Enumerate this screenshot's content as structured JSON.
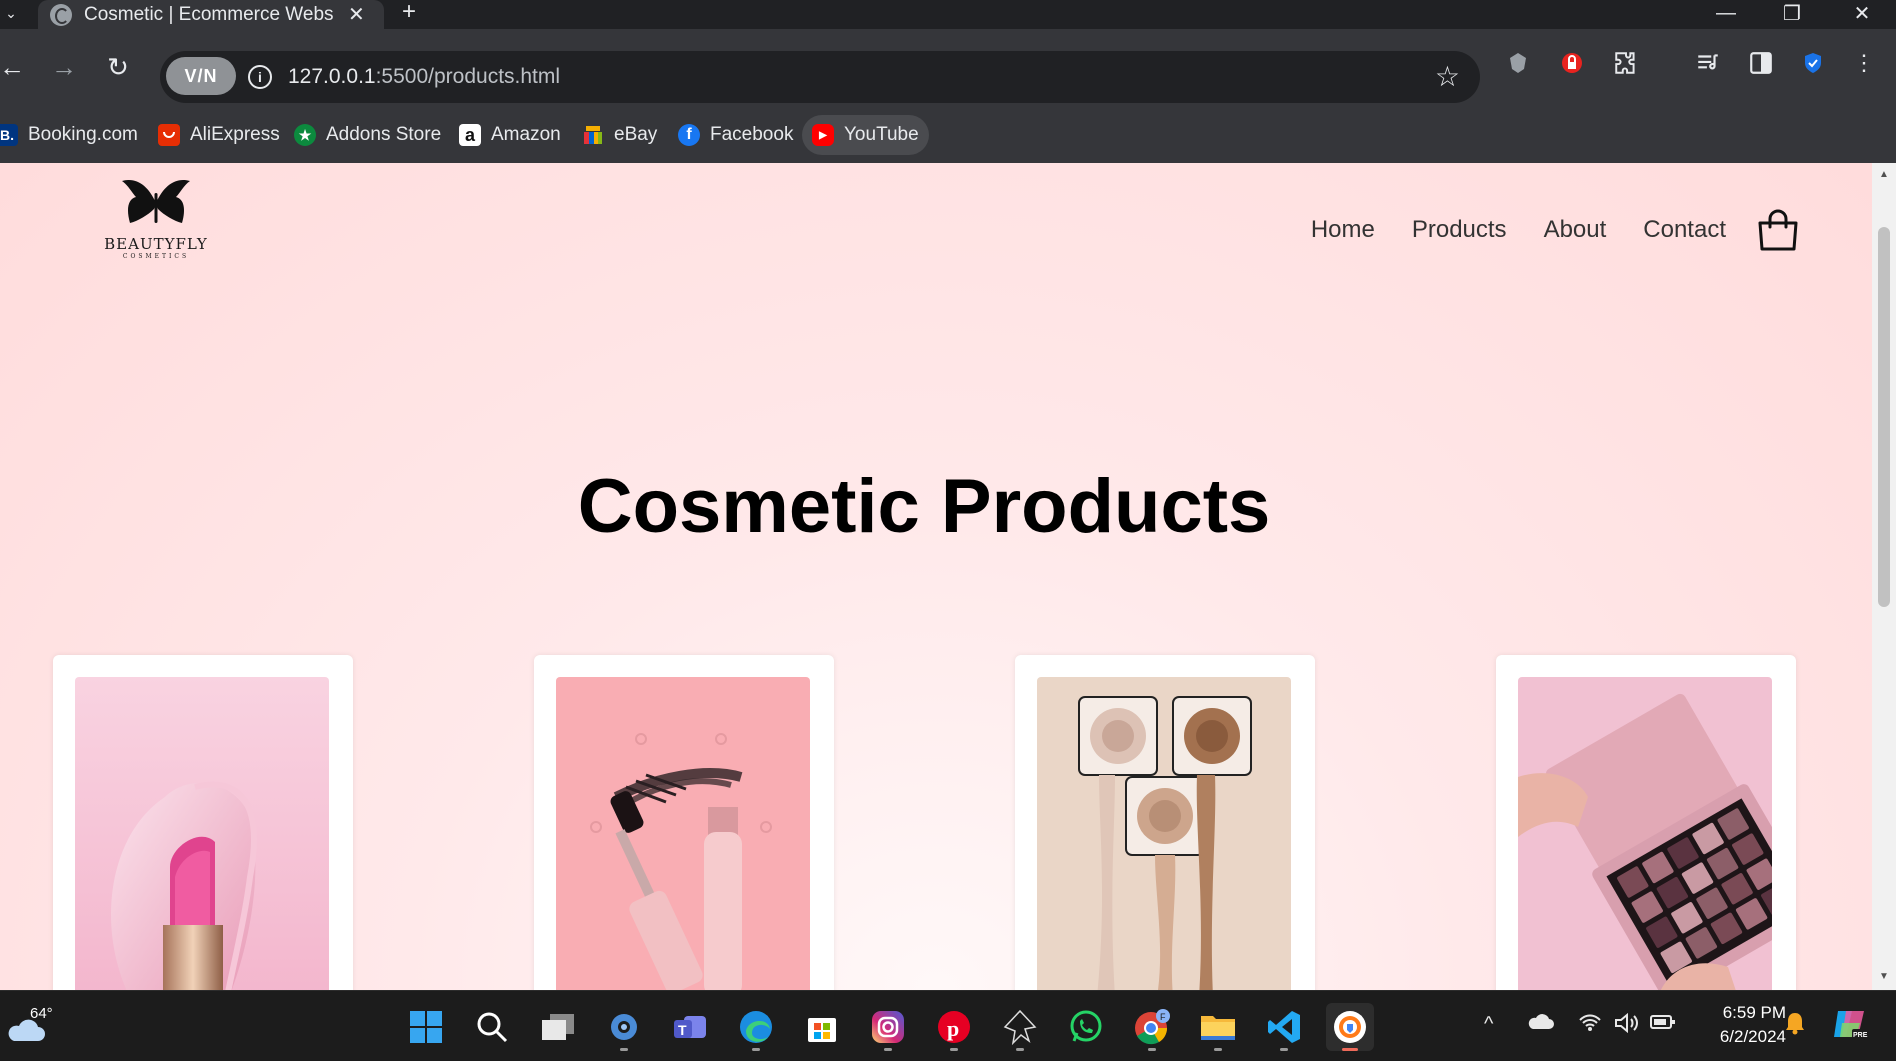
{
  "browser": {
    "tab_title": "Cosmetic | Ecommerce Website",
    "new_tab_symbol": "+",
    "url_host": "127.0.0.1",
    "url_path": ":5500/products.html",
    "vpn_label": "V/N"
  },
  "bookmarks": [
    {
      "label": "Booking.com",
      "icon": "booking-icon",
      "badge": "B.",
      "color": "#003580"
    },
    {
      "label": "AliExpress",
      "icon": "aliexpress-icon",
      "badge": "",
      "color": "#e62e04"
    },
    {
      "label": "Addons Store",
      "icon": "addons-store-icon",
      "badge": "★",
      "color": "#0c8a3e"
    },
    {
      "label": "Amazon",
      "icon": "amazon-icon",
      "badge": "a",
      "color": "#ffffff"
    },
    {
      "label": "eBay",
      "icon": "ebay-icon",
      "badge": "",
      "color": "#e53238"
    },
    {
      "label": "Facebook",
      "icon": "facebook-icon",
      "badge": "f",
      "color": "#1877f2"
    },
    {
      "label": "YouTube",
      "icon": "youtube-icon",
      "badge": "▶",
      "color": "#ff0000"
    }
  ],
  "site": {
    "logo_name": "BEAUTYFLY",
    "logo_sub": "COSMETICS",
    "nav": [
      "Home",
      "Products",
      "About",
      "Contact"
    ],
    "heading": "Cosmetic Products",
    "products": [
      {
        "image": "pink lipstick in flower petal",
        "bg": "#f7c9d8"
      },
      {
        "image": "mascara wand and tube",
        "bg": "#f9adb3"
      },
      {
        "image": "foundation swatches dripping",
        "bg": "#ead6c7"
      },
      {
        "image": "eyeshadow palette in hand",
        "bg": "#f1c1d2"
      }
    ]
  },
  "taskbar": {
    "weather_temp": "64°",
    "time": "6:59 PM",
    "date": "6/2/2024",
    "apps": [
      "start",
      "search",
      "task-view",
      "settings",
      "teams",
      "edge",
      "store",
      "instagram",
      "pinterest",
      "inkscape",
      "whatsapp",
      "chrome",
      "file-explorer",
      "vscode",
      "brave"
    ]
  },
  "colors": {
    "page_bg": "#ffe4e5",
    "browser_dark": "#202124",
    "browser_toolbar": "#35363a",
    "taskbar": "#1c1c1c"
  }
}
